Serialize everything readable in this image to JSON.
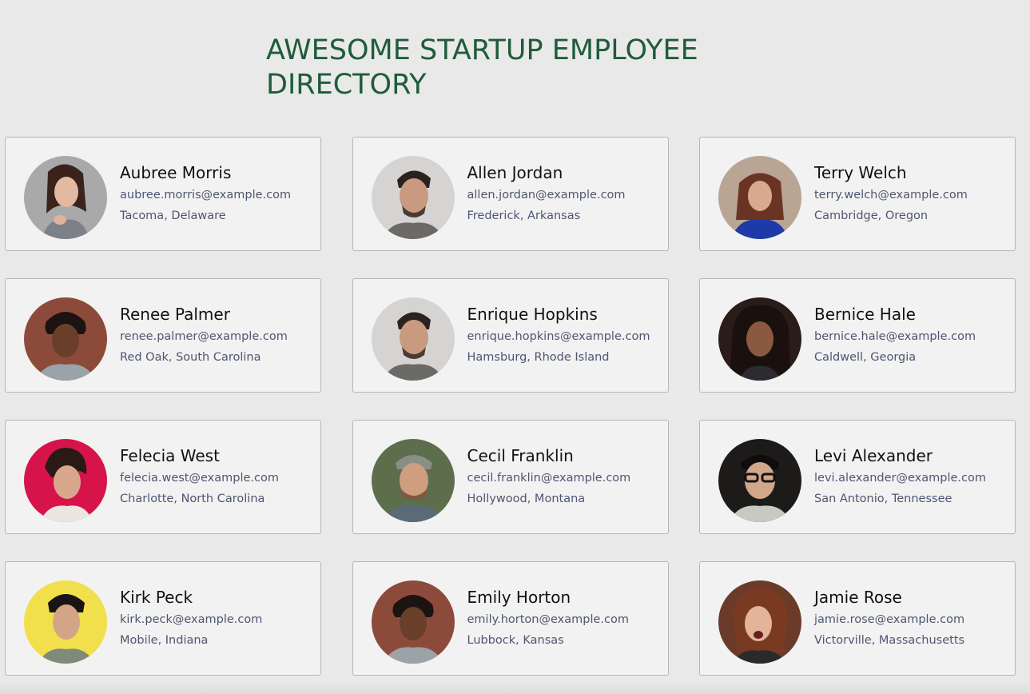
{
  "header": {
    "title_line1": "AWESOME STARTUP EMPLOYEE",
    "title_line2": "DIRECTORY"
  },
  "colors": {
    "title": "#1f5c3a",
    "card_bg": "#f2f2f2",
    "card_border": "#b7b7b7",
    "secondary_text": "#4f5572"
  },
  "employees": [
    {
      "name": "Aubree Morris",
      "email": "aubree.morris@example.com",
      "location": "Tacoma, Delaware",
      "avatar_icon": "avatar-photo"
    },
    {
      "name": "Allen Jordan",
      "email": "allen.jordan@example.com",
      "location": "Frederick, Arkansas",
      "avatar_icon": "avatar-photo"
    },
    {
      "name": "Terry Welch",
      "email": "terry.welch@example.com",
      "location": "Cambridge, Oregon",
      "avatar_icon": "avatar-photo"
    },
    {
      "name": "Renee Palmer",
      "email": "renee.palmer@example.com",
      "location": "Red Oak, South Carolina",
      "avatar_icon": "avatar-photo"
    },
    {
      "name": "Enrique Hopkins",
      "email": "enrique.hopkins@example.com",
      "location": "Hamsburg, Rhode Island",
      "avatar_icon": "avatar-photo"
    },
    {
      "name": "Bernice Hale",
      "email": "bernice.hale@example.com",
      "location": "Caldwell, Georgia",
      "avatar_icon": "avatar-photo"
    },
    {
      "name": "Felecia West",
      "email": "felecia.west@example.com",
      "location": "Charlotte, North Carolina",
      "avatar_icon": "avatar-photo"
    },
    {
      "name": "Cecil Franklin",
      "email": "cecil.franklin@example.com",
      "location": "Hollywood, Montana",
      "avatar_icon": "avatar-photo"
    },
    {
      "name": "Levi Alexander",
      "email": "levi.alexander@example.com",
      "location": "San Antonio, Tennessee",
      "avatar_icon": "avatar-photo"
    },
    {
      "name": "Kirk Peck",
      "email": "kirk.peck@example.com",
      "location": "Mobile, Indiana",
      "avatar_icon": "avatar-photo"
    },
    {
      "name": "Emily Horton",
      "email": "emily.horton@example.com",
      "location": "Lubbock, Kansas",
      "avatar_icon": "avatar-photo"
    },
    {
      "name": "Jamie Rose",
      "email": "jamie.rose@example.com",
      "location": "Victorville, Massachusetts",
      "avatar_icon": "avatar-photo"
    }
  ]
}
